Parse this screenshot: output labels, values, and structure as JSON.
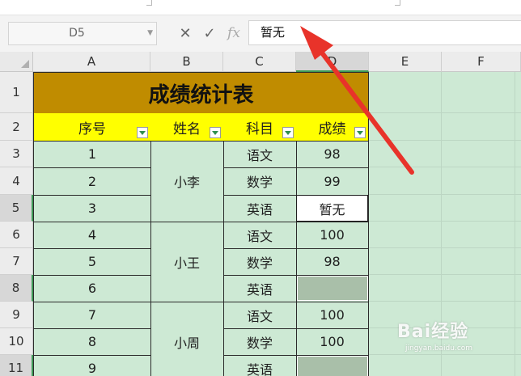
{
  "namebox": {
    "value": "D5"
  },
  "formula_bar": {
    "fx_label": "fx",
    "value": "暂无"
  },
  "columns": [
    "A",
    "B",
    "C",
    "D",
    "E",
    "F"
  ],
  "rows": [
    "1",
    "2",
    "3",
    "4",
    "5",
    "6",
    "7",
    "8",
    "9",
    "10",
    "11"
  ],
  "sheet": {
    "title": "成绩统计表",
    "headers": [
      "序号",
      "姓名",
      "科目",
      "成绩"
    ],
    "index": [
      "1",
      "2",
      "3",
      "4",
      "5",
      "6",
      "7",
      "8",
      "9"
    ],
    "names": [
      "小李",
      "小王",
      "小周"
    ],
    "subjects": [
      "语文",
      "数学",
      "英语",
      "语文",
      "数学",
      "英语",
      "语文",
      "数学",
      "英语"
    ],
    "scores": [
      "98",
      "99",
      "暂无",
      "100",
      "98",
      "",
      "100",
      "100",
      ""
    ]
  },
  "watermark": {
    "brand": "Bai经验",
    "url": "jingyan.baidu.com"
  },
  "colors": {
    "title_fill": "#c08c00",
    "header_fill": "#ffff00",
    "cell_fill": "#cde9d4",
    "blank_fill": "#a9bfa9",
    "arrow": "#e8332a"
  }
}
